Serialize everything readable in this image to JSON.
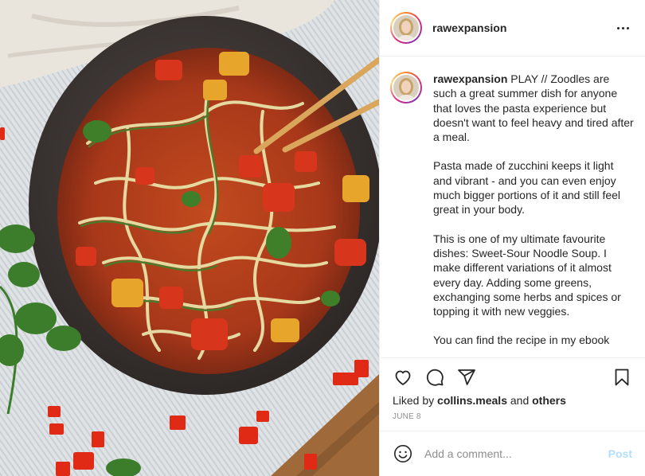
{
  "post": {
    "username": "rawexpansion",
    "caption_paragraphs": [
      "PLAY // Zoodles are such a great summer dish for anyone that loves the pasta experience but doesn't want to feel heavy and tired after a meal.",
      "Pasta made of zucchini keeps it light and vibrant - and you can even enjoy much bigger portions of it and still feel great in your body.",
      "This is one of my ultimate favourite dishes: Sweet-Sour Noodle Soup. I make different variations of it almost every day. Adding some greens, exchanging some herbs and spices or topping it with new veggies.",
      "You can find the recipe in my ebook"
    ],
    "likes": {
      "prefix": "Liked by",
      "user": "collins.meals",
      "joiner": "and",
      "others": "others"
    },
    "date": "JUNE 8"
  },
  "comment_box": {
    "placeholder": "Add a comment...",
    "post_label": "Post"
  },
  "icons": {
    "like": "heart-icon",
    "comment": "comment-bubble-icon",
    "share": "paper-plane-icon",
    "save": "bookmark-icon",
    "emoji": "smiley-icon",
    "more": "more-options-icon"
  },
  "colors": {
    "post_button": "#b2dffc",
    "muted": "#8e8e8e",
    "text": "#262626",
    "border": "#efefef"
  }
}
